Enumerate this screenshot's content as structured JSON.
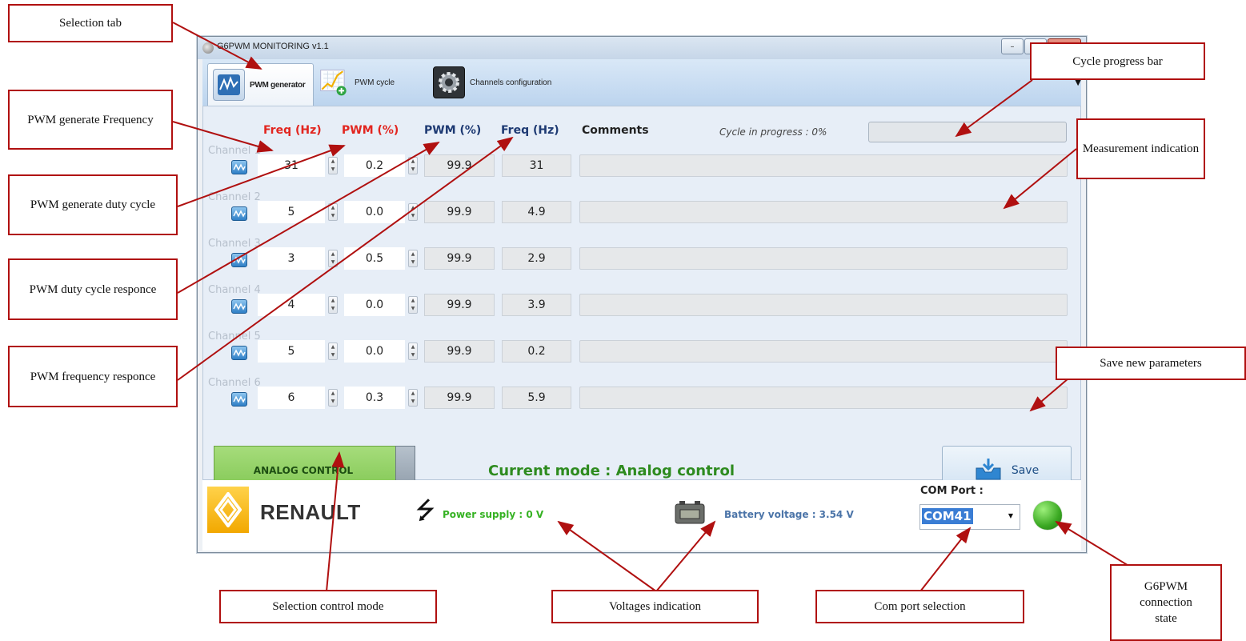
{
  "window": {
    "title": "G6PWM MONITORING v1.1",
    "minimize_glyph": "–",
    "maximize_glyph": "□",
    "close_glyph": "✕"
  },
  "tabs": [
    {
      "label": "PWM generator",
      "icon": "pwm-generator-icon",
      "active": true
    },
    {
      "label": "PWM cycle",
      "icon": "pwm-cycle-icon",
      "active": false
    },
    {
      "label": "Channels configuration",
      "icon": "gear-icon",
      "active": false
    }
  ],
  "table": {
    "headers": {
      "freq_gen": "Freq (Hz)",
      "pwm_gen": "PWM (%)",
      "pwm_resp": "PWM (%)",
      "freq_resp": "Freq (Hz)",
      "comments": "Comments"
    },
    "channels": [
      {
        "label": "Channel 1",
        "freq": "31",
        "pwm": "0.2",
        "pwm_resp": "99.9",
        "freq_resp": "31",
        "comment": ""
      },
      {
        "label": "Channel 2",
        "freq": "5",
        "pwm": "0.0",
        "pwm_resp": "99.9",
        "freq_resp": "4.9",
        "comment": ""
      },
      {
        "label": "Channel 3",
        "freq": "3",
        "pwm": "0.5",
        "pwm_resp": "99.9",
        "freq_resp": "2.9",
        "comment": ""
      },
      {
        "label": "Channel 4",
        "freq": "4",
        "pwm": "0.0",
        "pwm_resp": "99.9",
        "freq_resp": "3.9",
        "comment": ""
      },
      {
        "label": "Channel 5",
        "freq": "5",
        "pwm": "0.0",
        "pwm_resp": "99.9",
        "freq_resp": "0.2",
        "comment": ""
      },
      {
        "label": "Channel 6",
        "freq": "6",
        "pwm": "0.3",
        "pwm_resp": "99.9",
        "freq_resp": "5.9",
        "comment": ""
      }
    ]
  },
  "cycle": {
    "text": "Cycle in progress : 0%",
    "progress": 0
  },
  "controls": {
    "analog_button": "ANALOG CONTROL",
    "mode_text": "Current mode : Analog control",
    "save_label": "Save"
  },
  "footer": {
    "brand": "RENAULT",
    "power_supply": "Power supply : 0 V",
    "battery_voltage": "Battery voltage : 3.54 V",
    "com_label": "COM Port :",
    "com_value": "COM41",
    "connection_state": "connected"
  },
  "colors": {
    "red_header": "#e2251f",
    "blue_header": "#1e3a73",
    "mode_green": "#2e8b1f",
    "power_green": "#36b223",
    "battery_blue": "#4b74a8",
    "led_green": "#3aa822",
    "callout_border": "#b01010"
  },
  "annotations": [
    {
      "id": "selection-tab",
      "text": "Selection tab"
    },
    {
      "id": "pwm-generate-frequency",
      "text": "PWM generate Frequency"
    },
    {
      "id": "pwm-generate-duty-cycle",
      "text": "PWM generate duty cycle"
    },
    {
      "id": "pwm-duty-cycle-responce",
      "text": "PWM duty cycle responce"
    },
    {
      "id": "pwm-frequency-responce",
      "text": "PWM frequency responce"
    },
    {
      "id": "cycle-progress-bar",
      "text": "Cycle progress bar"
    },
    {
      "id": "measurement-indication",
      "text": "Measurement indication"
    },
    {
      "id": "save-new-parameters",
      "text": "Save new parameters"
    },
    {
      "id": "selection-control-mode",
      "text": "Selection control mode"
    },
    {
      "id": "voltages-indication",
      "text": "Voltages indication"
    },
    {
      "id": "com-port-selection",
      "text": "Com port selection"
    },
    {
      "id": "g6pwm-connection-state",
      "text": "G6PWM connection state"
    }
  ]
}
